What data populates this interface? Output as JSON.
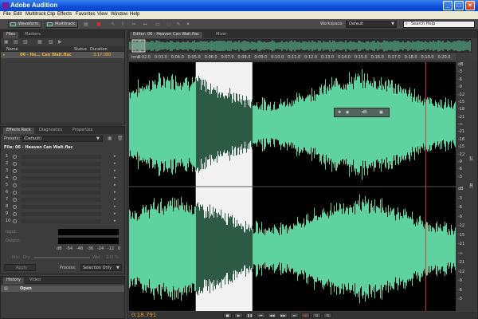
{
  "window": {
    "title": "Adobe Audition"
  },
  "menu": [
    "File",
    "Edit",
    "Multitrack",
    "Clip",
    "Effects",
    "Favorites",
    "View",
    "Window",
    "Help"
  ],
  "toolbar": {
    "waveform_label": "Waveform",
    "multitrack_label": "Multitrack",
    "workspace_label": "Workspace:",
    "workspace_value": "Default",
    "search_placeholder": "Search Help"
  },
  "files_panel": {
    "tabs": [
      "Files",
      "Markers"
    ],
    "columns": {
      "name": "Name",
      "status": "Status",
      "duration": "Duration"
    },
    "file": {
      "name": "06 - He... Can Wait.flac",
      "duration": "3:17.080"
    }
  },
  "effects_panel": {
    "tabs": [
      "Effects Rack",
      "Diagnostics",
      "Properties"
    ],
    "presets_label": "Presets:",
    "presets_value": "(Default)",
    "file_label": "File: 06 - Heaven Can Wait.flac",
    "slots": [
      "1",
      "2",
      "3",
      "4",
      "5",
      "6",
      "7",
      "8",
      "9",
      "10"
    ],
    "input_label": "Input:",
    "output_label": "Output:",
    "mix_label": "Mix:",
    "dry_label": "Dry",
    "wet_label": "Wet",
    "wet_value": "100 %",
    "meter_scale": [
      "dB",
      "-54",
      "-48",
      "-36",
      "-24",
      "-12",
      "0"
    ],
    "apply_label": "Apply",
    "process_label": "Process:",
    "process_value": "Selection Only"
  },
  "history_panel": {
    "tabs": [
      "History",
      "Video"
    ],
    "item": "Open"
  },
  "editor": {
    "tabs": [
      "Editor: 06 - Heaven Can Wait.flac",
      "Mixer"
    ],
    "ruler_unit": "hms",
    "ruler_ticks": [
      "0:02.0",
      "0:03.0",
      "0:04.0",
      "0:05.0",
      "0:06.0",
      "0:07.0",
      "0:08.0",
      "0:09.0",
      "0:10.0",
      "0:11.0",
      "0:12.0",
      "0:13.0",
      "0:14.0",
      "0:15.0",
      "0:16.0",
      "0:17.0",
      "0:18.0",
      "0:19.0",
      "0:20.0"
    ],
    "db_scale_top": [
      "dB",
      "-3",
      "-6",
      "-9",
      "-12",
      "-15",
      "-18",
      "-21",
      "-∞",
      "-21",
      "-18",
      "-15",
      "-12",
      "-9",
      "-6",
      "-3"
    ],
    "db_scale_bottom": [
      "dB",
      "-3",
      "-6",
      "-9",
      "-12",
      "-15",
      "-21",
      "-∞",
      "-21",
      "-12",
      "-9",
      "-6",
      "-3"
    ],
    "channels": [
      "L",
      "R"
    ],
    "hud_db": "dB",
    "selection": {
      "start_s": 5.0,
      "end_s": 8.4
    },
    "playhead_s": 18.8,
    "view_start_s": 1.0,
    "view_end_s": 20.6
  },
  "colors": {
    "wave": "#5ed3a0",
    "wave_selected": "#2d5a45",
    "selection_bg": "#f2f2f2",
    "background": "#000000"
  }
}
